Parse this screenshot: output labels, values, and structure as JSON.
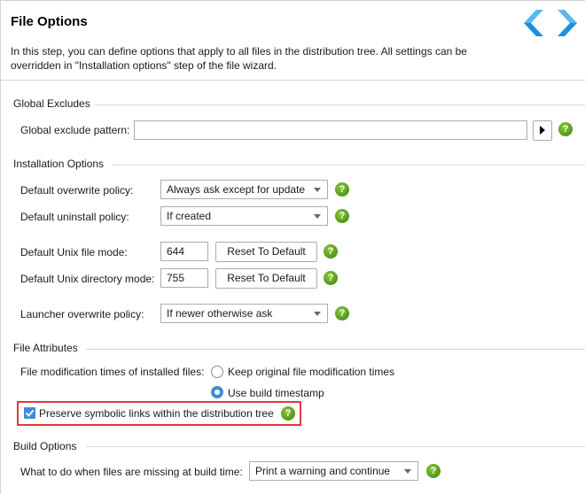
{
  "header": {
    "title": "File Options",
    "description": "In this step, you can define options that apply to all files in the distribution tree. All settings can be overridden in \"Installation options\" step of the file wizard.",
    "nav_back_icon": "chevron-left-icon",
    "nav_forward_icon": "chevron-right-icon",
    "accent_color": "#1e8fe0"
  },
  "global_excludes": {
    "section_title": "Global Excludes",
    "pattern_label": "Global exclude pattern:",
    "pattern_value": "",
    "insert_variable_icon": "triangle-right-icon",
    "help_icon": "help-icon"
  },
  "installation_options": {
    "section_title": "Installation Options",
    "overwrite_label": "Default overwrite policy:",
    "overwrite_value": "Always ask except for update",
    "uninstall_label": "Default uninstall policy:",
    "uninstall_value": "If created",
    "unix_file_mode_label": "Default Unix file mode:",
    "unix_file_mode_value": "644",
    "unix_dir_mode_label": "Default Unix directory mode:",
    "unix_dir_mode_value": "755",
    "reset_label": "Reset To Default",
    "launcher_overwrite_label": "Launcher overwrite policy:",
    "launcher_overwrite_value": "If newer otherwise ask"
  },
  "file_attributes": {
    "section_title": "File Attributes",
    "mod_times_label": "File modification times of installed files:",
    "radio_keep_label": "Keep original file modification times",
    "radio_keep_checked": false,
    "radio_build_label": "Use build timestamp",
    "radio_build_checked": true,
    "preserve_symlinks_label": "Preserve symbolic links within the distribution tree",
    "preserve_symlinks_checked": true,
    "highlight_color": "#e0393e"
  },
  "build_options": {
    "section_title": "Build Options",
    "missing_files_label": "What to do when files are missing at build time:",
    "missing_files_value": "Print a warning and continue"
  },
  "help_glyph": "?"
}
